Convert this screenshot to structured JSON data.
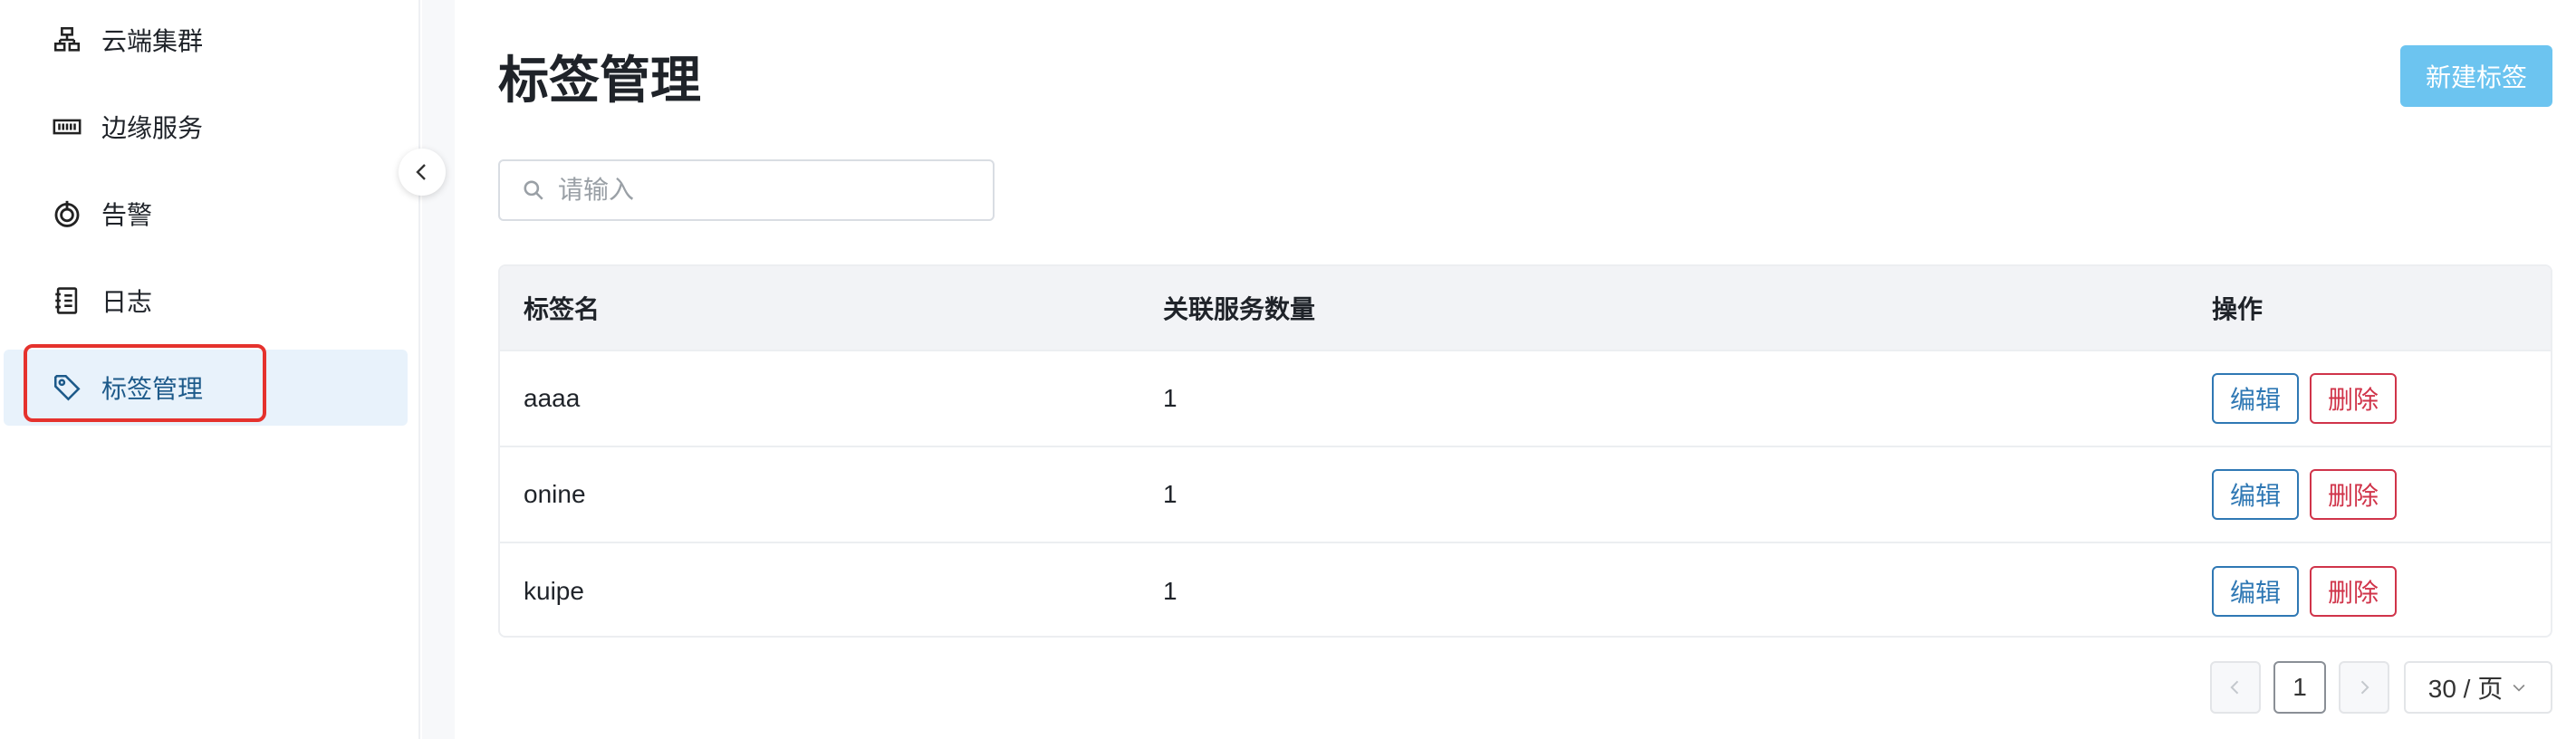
{
  "sidebar": {
    "items": [
      {
        "label": "云端集群",
        "icon": "cluster-icon"
      },
      {
        "label": "边缘服务",
        "icon": "edge-service-icon"
      },
      {
        "label": "告警",
        "icon": "alarm-icon"
      },
      {
        "label": "日志",
        "icon": "log-icon"
      },
      {
        "label": "标签管理",
        "icon": "tag-icon",
        "active": true
      }
    ]
  },
  "header": {
    "title": "标签管理",
    "new_button": "新建标签"
  },
  "search": {
    "placeholder": "请输入",
    "value": ""
  },
  "table": {
    "columns": [
      "标签名",
      "关联服务数量",
      "操作"
    ],
    "rows": [
      {
        "name": "aaaa",
        "count": "1",
        "edit": "编辑",
        "delete": "删除"
      },
      {
        "name": "onine",
        "count": "1",
        "edit": "编辑",
        "delete": "删除"
      },
      {
        "name": "kuipe",
        "count": "1",
        "edit": "编辑",
        "delete": "删除"
      }
    ]
  },
  "pagination": {
    "current_page": "1",
    "page_size": "30 / 页"
  },
  "colors": {
    "primary_button": "#6cc4f0",
    "edit": "#2f78b4",
    "delete": "#d0344a",
    "active_nav_bg": "#e8f2fb",
    "highlight": "#e5322d"
  }
}
